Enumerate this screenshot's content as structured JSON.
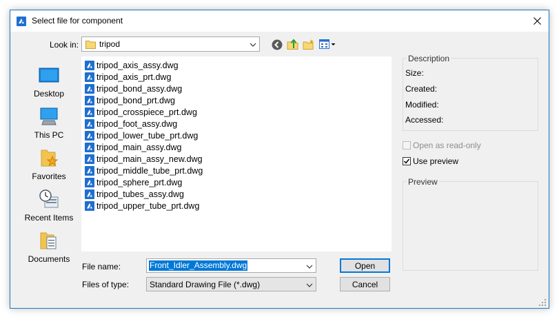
{
  "dialog": {
    "title": "Select file for component",
    "close_glyph": "✕"
  },
  "look_in": {
    "label": "Look in:",
    "value": "tripod"
  },
  "toolbar": {
    "icons": [
      "back-icon",
      "up-folder-icon",
      "new-folder-icon",
      "views-menu-icon"
    ]
  },
  "places": [
    {
      "label": "Desktop",
      "icon": "desktop-icon"
    },
    {
      "label": "This PC",
      "icon": "computer-icon"
    },
    {
      "label": "Favorites",
      "icon": "favorites-icon"
    },
    {
      "label": "Recent Items",
      "icon": "recent-items-icon"
    },
    {
      "label": "Documents",
      "icon": "documents-icon"
    }
  ],
  "files": [
    "tripod_axis_assy.dwg",
    "tripod_axis_prt.dwg",
    "tripod_bond_assy.dwg",
    "tripod_bond_prt.dwg",
    "tripod_crosspiece_prt.dwg",
    "tripod_foot_assy.dwg",
    "tripod_lower_tube_prt.dwg",
    "tripod_main_assy.dwg",
    "tripod_main_assy_new.dwg",
    "tripod_middle_tube_prt.dwg",
    "tripod_sphere_prt.dwg",
    "tripod_tubes_assy.dwg",
    "tripod_upper_tube_prt.dwg"
  ],
  "filename": {
    "label": "File name:",
    "value": "Front_Idler_Assembly.dwg"
  },
  "filetype": {
    "label": "Files of type:",
    "value": "Standard Drawing File (*.dwg)"
  },
  "buttons": {
    "open": "Open",
    "cancel": "Cancel"
  },
  "description": {
    "title": "Description",
    "size_label": "Size:",
    "created_label": "Created:",
    "modified_label": "Modified:",
    "accessed_label": "Accessed:"
  },
  "options": {
    "read_only_label": "Open as read-only",
    "read_only_checked": false,
    "read_only_enabled": false,
    "preview_label": "Use preview",
    "preview_checked": true
  },
  "preview": {
    "title": "Preview"
  },
  "colors": {
    "accent": "#0078d7",
    "file_icon": "#1f6fd0",
    "selection": "#0078d7"
  }
}
